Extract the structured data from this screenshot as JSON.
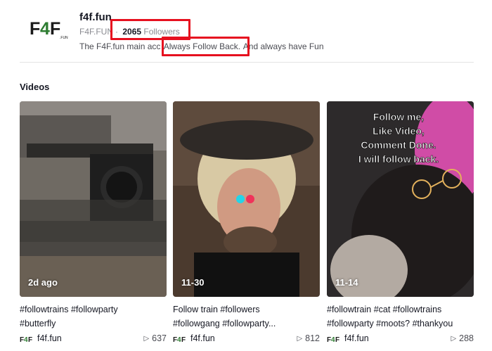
{
  "profile": {
    "name": "f4f.fun",
    "handle": "F4F.FUN",
    "separator": "·",
    "followers_count": "2065",
    "followers_label": "Followers",
    "bio_prefix": "The F4F.fun main acc",
    "bio_highlight": "Always Follow Back.",
    "bio_suffix": "And always have Fun",
    "logo_text": "F4F.FUN"
  },
  "section_title": "Videos",
  "videos": [
    {
      "overlay": "2d ago",
      "caption_line1": "#followtrains #followparty",
      "caption_line2": "#butterfly",
      "author": "f4f.fun",
      "views": "637"
    },
    {
      "overlay": "11-30",
      "caption_line1": "Follow train #followers",
      "caption_line2": "#followgang #followparty...",
      "author": "f4f.fun",
      "views": "812"
    },
    {
      "overlay": "11-14",
      "image_text": [
        "Follow me,",
        "Like Video,",
        "Comment Done.",
        "I will follow back."
      ],
      "caption_line1": "#followtrain #cat #followtrains",
      "caption_line2": "#followparty #moots? #thankyou",
      "author": "f4f.fun",
      "views": "288"
    }
  ],
  "colors": {
    "highlight_box": "#e6101f",
    "logo_dark": "#1a1a1a",
    "logo_green": "#2e7d32"
  },
  "icons": {
    "play": "play-icon"
  }
}
